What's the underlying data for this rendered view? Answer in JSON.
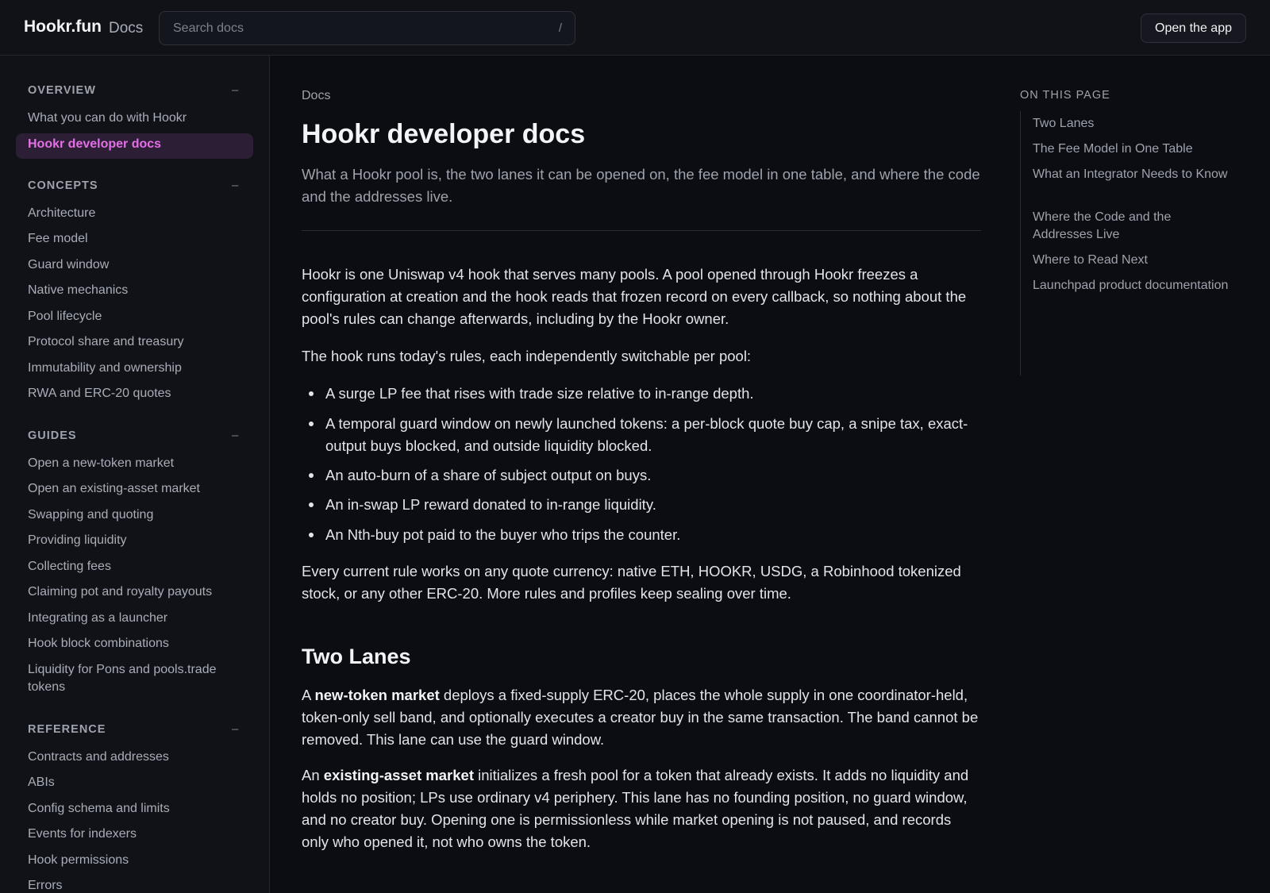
{
  "header": {
    "brand": "Hookr.fun",
    "brand_sub": "Docs",
    "search_placeholder": "Search docs",
    "search_shortcut": "/",
    "open_app_label": "Open the app"
  },
  "sidebar": {
    "sections": [
      {
        "title": "OVERVIEW",
        "toggle": "–",
        "items": [
          "What you can do with Hookr",
          "Hookr developer docs"
        ]
      },
      {
        "title": "CONCEPTS",
        "toggle": "–",
        "items": [
          "Architecture",
          "Fee model",
          "Guard window",
          "Native mechanics",
          "Pool lifecycle",
          "Protocol share and treasury",
          "Immutability and ownership",
          "RWA and ERC-20 quotes"
        ]
      },
      {
        "title": "GUIDES",
        "toggle": "–",
        "items": [
          "Open a new-token market",
          "Open an existing-asset market",
          "Swapping and quoting",
          "Providing liquidity",
          "Collecting fees",
          "Claiming pot and royalty payouts",
          "Integrating as a launcher",
          "Hook block combinations",
          "Liquidity for Pons and pools.trade tokens"
        ]
      },
      {
        "title": "REFERENCE",
        "toggle": "–",
        "items": [
          "Contracts and addresses",
          "ABIs",
          "Config schema and limits",
          "Events for indexers",
          "Hook permissions",
          "Errors"
        ]
      }
    ],
    "active_item": "Hookr developer docs"
  },
  "main": {
    "breadcrumb": "Docs",
    "title": "Hookr developer docs",
    "lead": "What a Hookr pool is, the two lanes it can be opened on, the fee model in one table, and where the code and the addresses live.",
    "intro_p1": "Hookr is one Uniswap v4 hook that serves many pools. A pool opened through Hookr freezes a configuration at creation and the hook reads that frozen record on every callback, so nothing about the pool's rules can change afterwards, including by the Hookr owner.",
    "intro_p2": "The hook runs today's rules, each independently switchable per pool:",
    "rules": [
      "A surge LP fee that rises with trade size relative to in-range depth.",
      "A temporal guard window on newly launched tokens: a per-block quote buy cap, a snipe tax, exact-output buys blocked, and outside liquidity blocked.",
      "An auto-burn of a share of subject output on buys.",
      "An in-swap LP reward donated to in-range liquidity.",
      "An Nth-buy pot paid to the buyer who trips the counter."
    ],
    "intro_p3": "Every current rule works on any quote currency: native ETH, HOOKR, USDG, a Robinhood tokenized stock, or any other ERC-20. More rules and profiles keep sealing over time.",
    "two_lanes": {
      "heading": "Two Lanes",
      "p1_prefix": "A ",
      "p1_bold": "new-token market",
      "p1_rest": " deploys a fixed-supply ERC-20, places the whole supply in one coordinator-held, token-only sell band, and optionally executes a creator buy in the same transaction. The band cannot be removed. This lane can use the guard window.",
      "p2_prefix": "An ",
      "p2_bold": "existing-asset market",
      "p2_rest": " initializes a fresh pool for a token that already exists. It adds no liquidity and holds no position; LPs use ordinary v4 periphery. This lane has no founding position, no guard window, and no creator buy. Opening one is permissionless while market opening is not paused, and records only who opened it, not who owns the token."
    }
  },
  "toc": {
    "heading": "ON THIS PAGE",
    "items": [
      "Two Lanes",
      "The Fee Model in One Table",
      "What an Integrator Needs to Know",
      "Where the Code and the Addresses Live",
      "Where to Read Next",
      "Launchpad product documentation"
    ]
  },
  "colors": {
    "background": "#0c0d12",
    "panel": "#111218",
    "accent": "#e46fe6",
    "active_bg": "#2c1f35"
  }
}
